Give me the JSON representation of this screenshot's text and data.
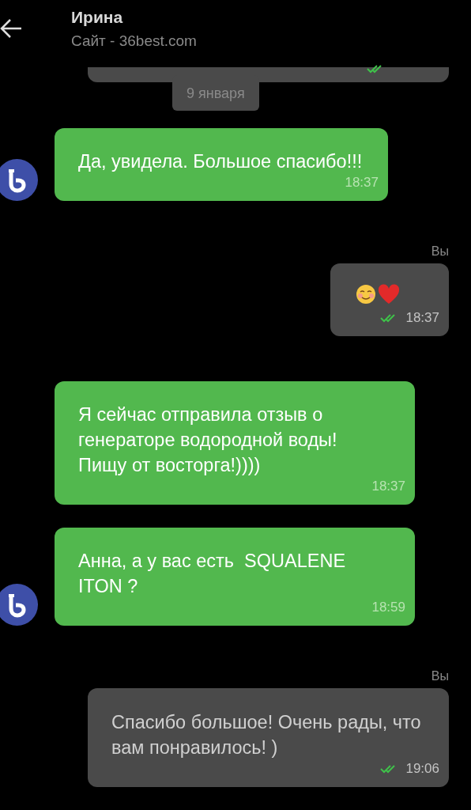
{
  "header": {
    "title": "Ирина",
    "subtitle": "Сайт - 36best.com"
  },
  "date_chip": "9 января",
  "messages": [
    {
      "kind": "incoming",
      "text": "Да, увидела. Большое спасибо!!!",
      "time": "18:37",
      "avatar": true
    },
    {
      "kind": "emoji",
      "sender": "Вы",
      "time": "18:37",
      "read": true
    },
    {
      "kind": "incoming",
      "text": "Я сейчас отправила отзыв о генераторе водородной воды! Пищу от восторга!))))",
      "time": "18:37",
      "avatar": false
    },
    {
      "kind": "incoming",
      "text": "Анна, а у вас есть  SQUALENE ITON ?",
      "time": "18:59",
      "avatar": true
    },
    {
      "kind": "outgoing",
      "sender": "Вы",
      "text": "Спасибо большое! Очень рады, что вам понравилось! )",
      "time": "19:06",
      "read": true
    }
  ]
}
